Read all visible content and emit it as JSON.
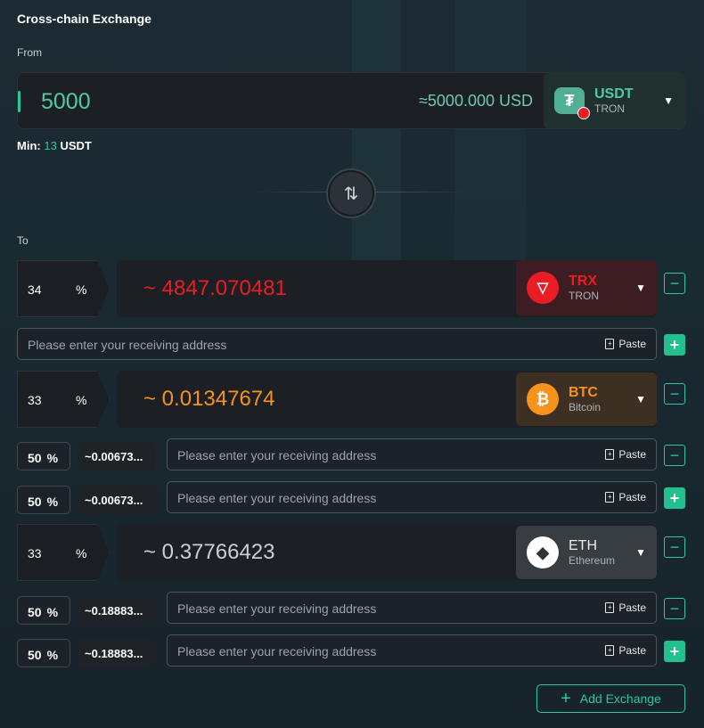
{
  "title": "Cross-chain Exchange",
  "from": {
    "label": "From",
    "amount": "5000",
    "usd": "≈5000.000 USD",
    "token": {
      "symbol": "USDT",
      "network": "TRON",
      "color": "#50af95"
    },
    "min_label": "Min:",
    "min_value": "13",
    "min_unit": "USDT"
  },
  "to": {
    "label": "To"
  },
  "placeholder": "Please enter your receiving address",
  "paste": "Paste",
  "percent_sign": "%",
  "rows": [
    {
      "pct": "34",
      "amount": "~ 4847.070481",
      "token": {
        "symbol": "TRX",
        "network": "TRON"
      }
    },
    {
      "pct": "33",
      "amount": "~ 0.01347674",
      "token": {
        "symbol": "BTC",
        "network": "Bitcoin"
      },
      "subs": [
        {
          "pct": "50",
          "amount": "~0.00673..."
        },
        {
          "pct": "50",
          "amount": "~0.00673..."
        }
      ]
    },
    {
      "pct": "33",
      "amount": "~ 0.37766423",
      "token": {
        "symbol": "ETH",
        "network": "Ethereum"
      },
      "subs": [
        {
          "pct": "50",
          "amount": "~0.18883..."
        },
        {
          "pct": "50",
          "amount": "~0.18883..."
        }
      ]
    }
  ],
  "add_exchange": "Add Exchange",
  "colors": {
    "accent": "#2fc6a0",
    "trx": "#ea1d25",
    "btc": "#f7931a",
    "eth": "#c9cfd2"
  }
}
